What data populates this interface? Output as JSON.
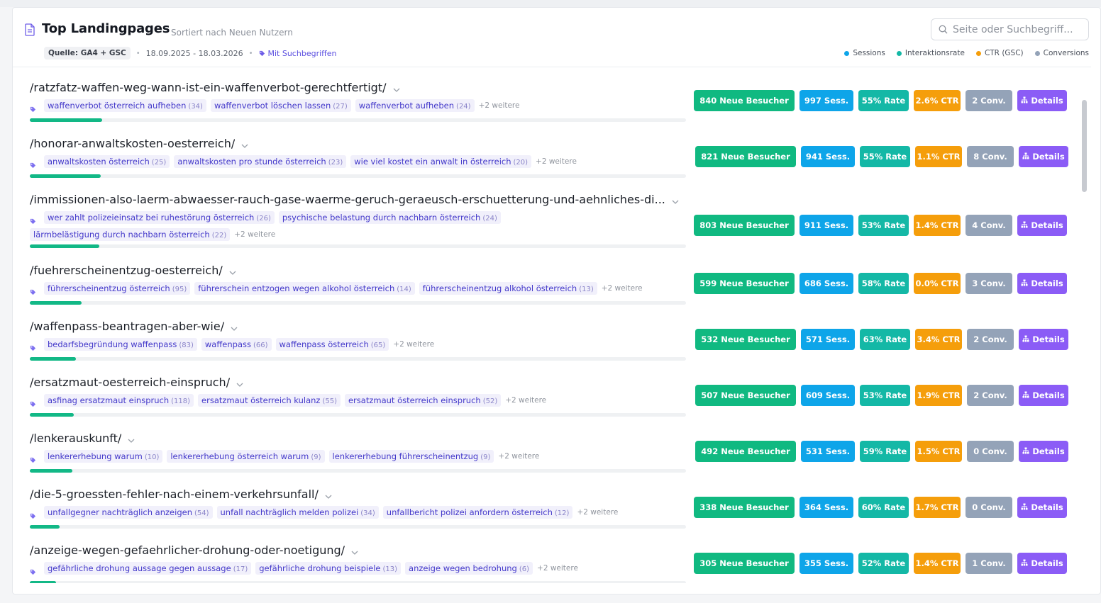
{
  "header": {
    "title": "Top Landingpages",
    "subtitle": "Sortiert nach Neuen Nutzern",
    "search_placeholder": "Seite oder Suchbegriff...",
    "source_label": "Quelle: GA4 + GSC",
    "date_range": "18.09.2025 - 18.03.2026",
    "with_terms_label": "Mit Suchbegriffen"
  },
  "legend": [
    {
      "label": "Sessions",
      "color": "#0ea5e9"
    },
    {
      "label": "Interaktionsrate",
      "color": "#14b8a6"
    },
    {
      "label": "CTR (GSC)",
      "color": "#f59e0b"
    },
    {
      "label": "Conversions",
      "color": "#94a3b8"
    }
  ],
  "colors": {
    "new_visitors": "#10b981",
    "sessions": "#0ea5e9",
    "rate": "#14b8a6",
    "ctr": "#f59e0b",
    "conversions": "#94a3b8",
    "details": "#8b5cf6",
    "progress": "#12b886",
    "keyword": "#4338ca"
  },
  "icons": {
    "header": "document-icon",
    "search": "search-icon",
    "tag": "tag-icon",
    "chevron": "chevron-down-icon",
    "details": "sitemap-icon"
  },
  "rows": [
    {
      "url": "/ratzfatz-waffen-weg-wann-ist-ein-waffenverbot-gerechtfertigt/",
      "keywords": [
        {
          "term": "waffenverbot österreich aufheben",
          "count": "(34)"
        },
        {
          "term": "waffenverbot löschen lassen",
          "count": "(27)"
        },
        {
          "term": "waffenverbot aufheben",
          "count": "(24)"
        }
      ],
      "more": "+2 weitere",
      "progress": 0.11,
      "new_visitors": "840 Neue Besucher",
      "sessions": "997 Sess.",
      "rate": "55% Rate",
      "ctr": "2.6% CTR",
      "conversions": "2 Conv.",
      "details": "Details"
    },
    {
      "url": "/honorar-anwaltskosten-oesterreich/",
      "keywords": [
        {
          "term": "anwaltskosten österreich",
          "count": "(25)"
        },
        {
          "term": "anwaltskosten pro stunde österreich",
          "count": "(23)"
        },
        {
          "term": "wie viel kostet ein anwalt in österreich",
          "count": "(20)"
        }
      ],
      "more": "+2 weitere",
      "progress": 0.108,
      "new_visitors": "821 Neue Besucher",
      "sessions": "941 Sess.",
      "rate": "55% Rate",
      "ctr": "1.1% CTR",
      "conversions": "8 Conv.",
      "details": "Details"
    },
    {
      "url": "/immissionen-also-laerm-abwaesser-rauch-gase-waerme-geruch-geraeusch-erschuetterung-und-aehnliches-di...",
      "keywords": [
        {
          "term": "wer zahlt polizeieinsatz bei ruhestörung österreich",
          "count": "(26)"
        },
        {
          "term": "psychische belastung durch nachbarn österreich",
          "count": "(24)"
        },
        {
          "term": "lärmbelästigung durch nachbarn österreich",
          "count": "(22)"
        }
      ],
      "more": "+2 weitere",
      "progress": 0.106,
      "new_visitors": "803 Neue Besucher",
      "sessions": "911 Sess.",
      "rate": "53% Rate",
      "ctr": "1.4% CTR",
      "conversions": "4 Conv.",
      "details": "Details"
    },
    {
      "url": "/fuehrerscheinentzug-oesterreich/",
      "keywords": [
        {
          "term": "führerscheinentzug österreich",
          "count": "(95)"
        },
        {
          "term": "führerschein entzogen wegen alkohol österreich",
          "count": "(14)"
        },
        {
          "term": "führerscheinentzug alkohol österreich",
          "count": "(13)"
        }
      ],
      "more": "+2 weitere",
      "progress": 0.079,
      "new_visitors": "599 Neue Besucher",
      "sessions": "686 Sess.",
      "rate": "58% Rate",
      "ctr": "0.0% CTR",
      "conversions": "3 Conv.",
      "details": "Details"
    },
    {
      "url": "/waffenpass-beantragen-aber-wie/",
      "keywords": [
        {
          "term": "bedarfsbegründung waffenpass",
          "count": "(83)"
        },
        {
          "term": "waffenpass",
          "count": "(66)"
        },
        {
          "term": "waffenpass österreich",
          "count": "(65)"
        }
      ],
      "more": "+2 weitere",
      "progress": 0.07,
      "new_visitors": "532 Neue Besucher",
      "sessions": "571 Sess.",
      "rate": "63% Rate",
      "ctr": "3.4% CTR",
      "conversions": "2 Conv.",
      "details": "Details"
    },
    {
      "url": "/ersatzmaut-oesterreich-einspruch/",
      "keywords": [
        {
          "term": "asfinag ersatzmaut einspruch",
          "count": "(118)"
        },
        {
          "term": "ersatzmaut österreich kulanz",
          "count": "(55)"
        },
        {
          "term": "ersatzmaut österreich einspruch",
          "count": "(52)"
        }
      ],
      "more": "+2 weitere",
      "progress": 0.067,
      "new_visitors": "507 Neue Besucher",
      "sessions": "609 Sess.",
      "rate": "53% Rate",
      "ctr": "1.9% CTR",
      "conversions": "2 Conv.",
      "details": "Details"
    },
    {
      "url": "/lenkerauskunft/",
      "keywords": [
        {
          "term": "lenkererhebung warum",
          "count": "(10)"
        },
        {
          "term": "lenkererhebung österreich warum",
          "count": "(9)"
        },
        {
          "term": "lenkererhebung führerscheinentzug",
          "count": "(9)"
        }
      ],
      "more": "+2 weitere",
      "progress": 0.065,
      "new_visitors": "492 Neue Besucher",
      "sessions": "531 Sess.",
      "rate": "59% Rate",
      "ctr": "1.5% CTR",
      "conversions": "0 Conv.",
      "details": "Details"
    },
    {
      "url": "/die-5-groessten-fehler-nach-einem-verkehrsunfall/",
      "keywords": [
        {
          "term": "unfallgegner nachträglich anzeigen",
          "count": "(54)"
        },
        {
          "term": "unfall nachträglich melden polizei",
          "count": "(34)"
        },
        {
          "term": "unfallbericht polizei anfordern österreich",
          "count": "(12)"
        }
      ],
      "more": "+2 weitere",
      "progress": 0.045,
      "new_visitors": "338 Neue Besucher",
      "sessions": "364 Sess.",
      "rate": "60% Rate",
      "ctr": "1.7% CTR",
      "conversions": "0 Conv.",
      "details": "Details"
    },
    {
      "url": "/anzeige-wegen-gefaehrlicher-drohung-oder-noetigung/",
      "keywords": [
        {
          "term": "gefährliche drohung aussage gegen aussage",
          "count": "(17)"
        },
        {
          "term": "gefährliche drohung beispiele",
          "count": "(13)"
        },
        {
          "term": "anzeige wegen bedrohung",
          "count": "(6)"
        }
      ],
      "more": "+2 weitere",
      "progress": 0.04,
      "new_visitors": "305 Neue Besucher",
      "sessions": "355 Sess.",
      "rate": "52% Rate",
      "ctr": "1.4% CTR",
      "conversions": "1 Conv.",
      "details": "Details"
    }
  ]
}
